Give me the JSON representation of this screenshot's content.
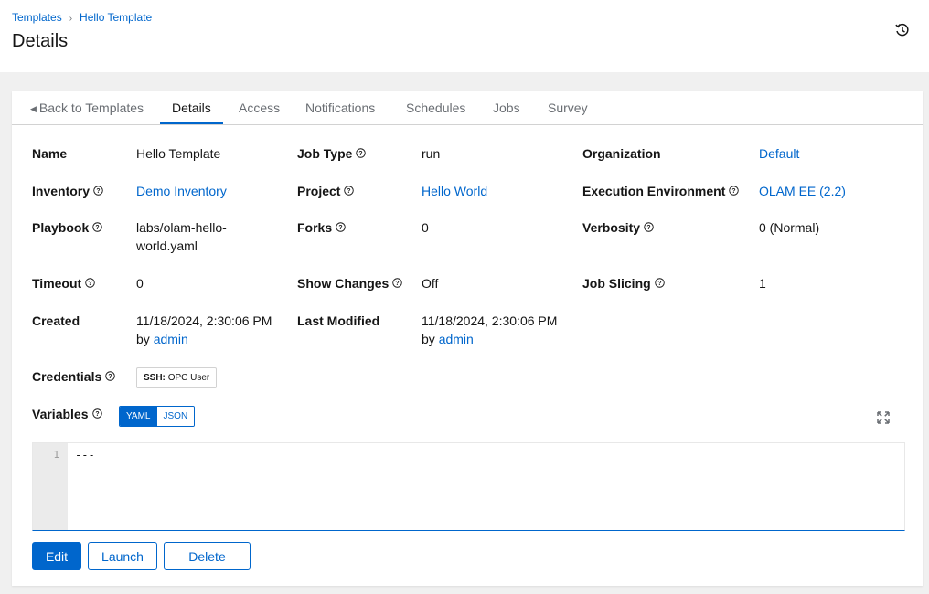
{
  "breadcrumb": {
    "parent": "Templates",
    "separator": "›",
    "current": "Hello Template"
  },
  "page_title": "Details",
  "tabs": [
    {
      "label": "Back to Templates"
    },
    {
      "label": "Details"
    },
    {
      "label": "Access"
    },
    {
      "label": "Notifications"
    },
    {
      "label": "Schedules"
    },
    {
      "label": "Jobs"
    },
    {
      "label": "Survey"
    }
  ],
  "details": {
    "name": {
      "label": "Name",
      "value": "Hello Template"
    },
    "job_type": {
      "label": "Job Type",
      "value": "run"
    },
    "organization": {
      "label": "Organization",
      "value": "Default"
    },
    "inventory": {
      "label": "Inventory",
      "value": "Demo Inventory"
    },
    "project": {
      "label": "Project",
      "value": "Hello World"
    },
    "execution_environment": {
      "label": "Execution Environment",
      "value": "OLAM EE (2.2)"
    },
    "playbook": {
      "label": "Playbook",
      "value_line1": "labs/olam-hello-",
      "value_line2": "world.yaml"
    },
    "forks": {
      "label": "Forks",
      "value": "0"
    },
    "verbosity": {
      "label": "Verbosity",
      "value": "0 (Normal)"
    },
    "timeout": {
      "label": "Timeout",
      "value": "0"
    },
    "show_changes": {
      "label": "Show Changes",
      "value": "Off"
    },
    "job_slicing": {
      "label": "Job Slicing",
      "value": "1"
    },
    "created": {
      "label": "Created",
      "date": "11/18/2024, 2:30:06 PM",
      "by": "by",
      "user": "admin"
    },
    "last_modified": {
      "label": "Last Modified",
      "date": "11/18/2024, 2:30:06 PM",
      "by": "by",
      "user": "admin"
    },
    "credentials": {
      "label": "Credentials",
      "chip_type": "SSH:",
      "chip_name": "OPC User"
    },
    "variables": {
      "label": "Variables",
      "yaml": "YAML",
      "json": "JSON"
    }
  },
  "editor": {
    "line_number": "1",
    "content": "---"
  },
  "buttons": {
    "edit": "Edit",
    "launch": "Launch",
    "delete": "Delete"
  },
  "colors": {
    "accent": "#0066cc",
    "background": "#f0f0f0",
    "card": "#ffffff"
  }
}
